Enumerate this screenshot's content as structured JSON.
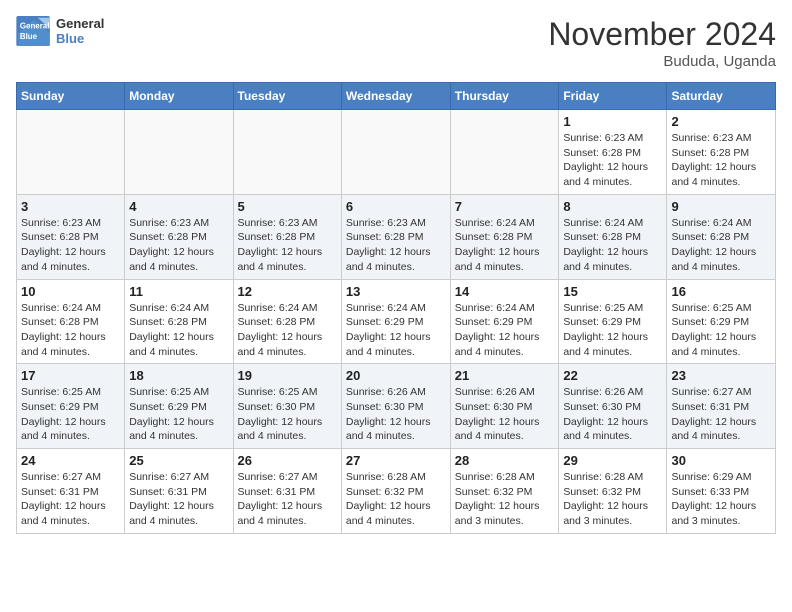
{
  "logo": {
    "text_general": "General",
    "text_blue": "Blue"
  },
  "title": {
    "month": "November 2024",
    "location": "Bududa, Uganda"
  },
  "weekdays": [
    "Sunday",
    "Monday",
    "Tuesday",
    "Wednesday",
    "Thursday",
    "Friday",
    "Saturday"
  ],
  "weeks": [
    [
      {
        "day": "",
        "empty": true
      },
      {
        "day": "",
        "empty": true
      },
      {
        "day": "",
        "empty": true
      },
      {
        "day": "",
        "empty": true
      },
      {
        "day": "",
        "empty": true
      },
      {
        "day": "1",
        "sunrise": "Sunrise: 6:23 AM",
        "sunset": "Sunset: 6:28 PM",
        "daylight": "Daylight: 12 hours and 4 minutes."
      },
      {
        "day": "2",
        "sunrise": "Sunrise: 6:23 AM",
        "sunset": "Sunset: 6:28 PM",
        "daylight": "Daylight: 12 hours and 4 minutes."
      }
    ],
    [
      {
        "day": "3",
        "sunrise": "Sunrise: 6:23 AM",
        "sunset": "Sunset: 6:28 PM",
        "daylight": "Daylight: 12 hours and 4 minutes."
      },
      {
        "day": "4",
        "sunrise": "Sunrise: 6:23 AM",
        "sunset": "Sunset: 6:28 PM",
        "daylight": "Daylight: 12 hours and 4 minutes."
      },
      {
        "day": "5",
        "sunrise": "Sunrise: 6:23 AM",
        "sunset": "Sunset: 6:28 PM",
        "daylight": "Daylight: 12 hours and 4 minutes."
      },
      {
        "day": "6",
        "sunrise": "Sunrise: 6:23 AM",
        "sunset": "Sunset: 6:28 PM",
        "daylight": "Daylight: 12 hours and 4 minutes."
      },
      {
        "day": "7",
        "sunrise": "Sunrise: 6:24 AM",
        "sunset": "Sunset: 6:28 PM",
        "daylight": "Daylight: 12 hours and 4 minutes."
      },
      {
        "day": "8",
        "sunrise": "Sunrise: 6:24 AM",
        "sunset": "Sunset: 6:28 PM",
        "daylight": "Daylight: 12 hours and 4 minutes."
      },
      {
        "day": "9",
        "sunrise": "Sunrise: 6:24 AM",
        "sunset": "Sunset: 6:28 PM",
        "daylight": "Daylight: 12 hours and 4 minutes."
      }
    ],
    [
      {
        "day": "10",
        "sunrise": "Sunrise: 6:24 AM",
        "sunset": "Sunset: 6:28 PM",
        "daylight": "Daylight: 12 hours and 4 minutes."
      },
      {
        "day": "11",
        "sunrise": "Sunrise: 6:24 AM",
        "sunset": "Sunset: 6:28 PM",
        "daylight": "Daylight: 12 hours and 4 minutes."
      },
      {
        "day": "12",
        "sunrise": "Sunrise: 6:24 AM",
        "sunset": "Sunset: 6:28 PM",
        "daylight": "Daylight: 12 hours and 4 minutes."
      },
      {
        "day": "13",
        "sunrise": "Sunrise: 6:24 AM",
        "sunset": "Sunset: 6:29 PM",
        "daylight": "Daylight: 12 hours and 4 minutes."
      },
      {
        "day": "14",
        "sunrise": "Sunrise: 6:24 AM",
        "sunset": "Sunset: 6:29 PM",
        "daylight": "Daylight: 12 hours and 4 minutes."
      },
      {
        "day": "15",
        "sunrise": "Sunrise: 6:25 AM",
        "sunset": "Sunset: 6:29 PM",
        "daylight": "Daylight: 12 hours and 4 minutes."
      },
      {
        "day": "16",
        "sunrise": "Sunrise: 6:25 AM",
        "sunset": "Sunset: 6:29 PM",
        "daylight": "Daylight: 12 hours and 4 minutes."
      }
    ],
    [
      {
        "day": "17",
        "sunrise": "Sunrise: 6:25 AM",
        "sunset": "Sunset: 6:29 PM",
        "daylight": "Daylight: 12 hours and 4 minutes."
      },
      {
        "day": "18",
        "sunrise": "Sunrise: 6:25 AM",
        "sunset": "Sunset: 6:29 PM",
        "daylight": "Daylight: 12 hours and 4 minutes."
      },
      {
        "day": "19",
        "sunrise": "Sunrise: 6:25 AM",
        "sunset": "Sunset: 6:30 PM",
        "daylight": "Daylight: 12 hours and 4 minutes."
      },
      {
        "day": "20",
        "sunrise": "Sunrise: 6:26 AM",
        "sunset": "Sunset: 6:30 PM",
        "daylight": "Daylight: 12 hours and 4 minutes."
      },
      {
        "day": "21",
        "sunrise": "Sunrise: 6:26 AM",
        "sunset": "Sunset: 6:30 PM",
        "daylight": "Daylight: 12 hours and 4 minutes."
      },
      {
        "day": "22",
        "sunrise": "Sunrise: 6:26 AM",
        "sunset": "Sunset: 6:30 PM",
        "daylight": "Daylight: 12 hours and 4 minutes."
      },
      {
        "day": "23",
        "sunrise": "Sunrise: 6:27 AM",
        "sunset": "Sunset: 6:31 PM",
        "daylight": "Daylight: 12 hours and 4 minutes."
      }
    ],
    [
      {
        "day": "24",
        "sunrise": "Sunrise: 6:27 AM",
        "sunset": "Sunset: 6:31 PM",
        "daylight": "Daylight: 12 hours and 4 minutes."
      },
      {
        "day": "25",
        "sunrise": "Sunrise: 6:27 AM",
        "sunset": "Sunset: 6:31 PM",
        "daylight": "Daylight: 12 hours and 4 minutes."
      },
      {
        "day": "26",
        "sunrise": "Sunrise: 6:27 AM",
        "sunset": "Sunset: 6:31 PM",
        "daylight": "Daylight: 12 hours and 4 minutes."
      },
      {
        "day": "27",
        "sunrise": "Sunrise: 6:28 AM",
        "sunset": "Sunset: 6:32 PM",
        "daylight": "Daylight: 12 hours and 4 minutes."
      },
      {
        "day": "28",
        "sunrise": "Sunrise: 6:28 AM",
        "sunset": "Sunset: 6:32 PM",
        "daylight": "Daylight: 12 hours and 3 minutes."
      },
      {
        "day": "29",
        "sunrise": "Sunrise: 6:28 AM",
        "sunset": "Sunset: 6:32 PM",
        "daylight": "Daylight: 12 hours and 3 minutes."
      },
      {
        "day": "30",
        "sunrise": "Sunrise: 6:29 AM",
        "sunset": "Sunset: 6:33 PM",
        "daylight": "Daylight: 12 hours and 3 minutes."
      }
    ]
  ]
}
